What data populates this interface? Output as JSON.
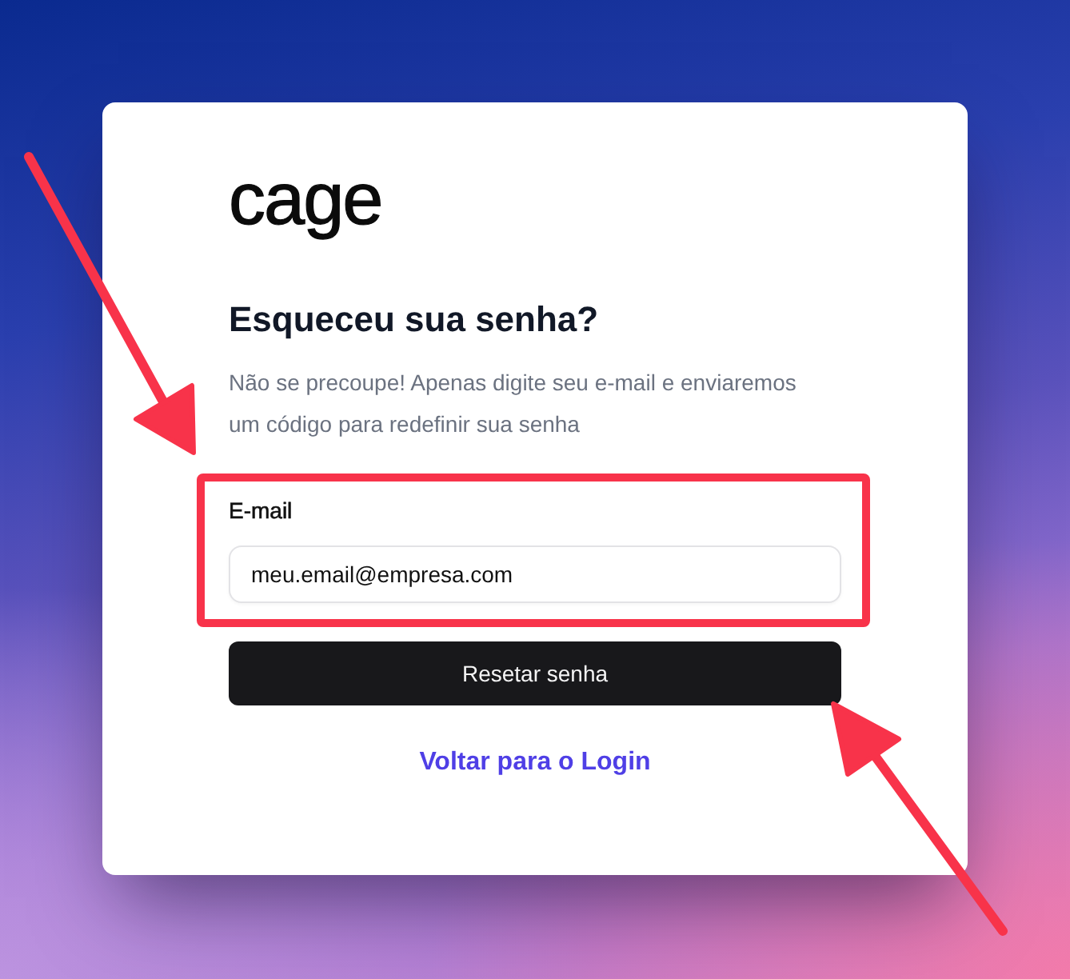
{
  "logo": {
    "text": "cage"
  },
  "heading": "Esqueceu sua senha?",
  "description": "Não se precoupe! Apenas digite seu e-mail e enviaremos um código para redefinir sua senha",
  "form": {
    "email": {
      "label": "E-mail",
      "value": "meu.email@empresa.com",
      "highlighted": true
    },
    "submit": "Resetar senha"
  },
  "back_link": "Voltar para o Login"
}
